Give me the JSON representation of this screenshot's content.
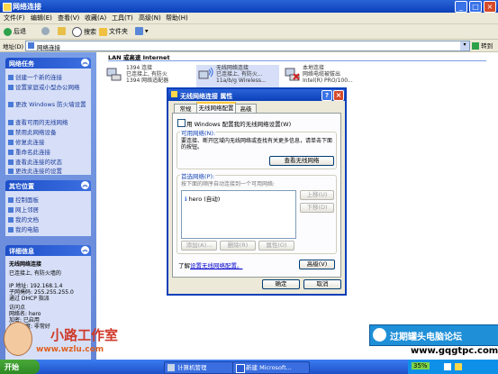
{
  "window": {
    "title": "网络连接"
  },
  "menu": [
    "文件(F)",
    "编辑(E)",
    "查看(V)",
    "收藏(A)",
    "工具(T)",
    "高级(N)",
    "帮助(H)"
  ],
  "toolbar": {
    "back": "后退",
    "search": "搜索",
    "folders": "文件夹"
  },
  "address": {
    "label": "地址(D)",
    "value": "网络连接",
    "go": "转到"
  },
  "left": {
    "network_tasks": {
      "title": "网络任务",
      "items": [
        "创建一个新的连接",
        "设置家庭或小型办公网络",
        "更改 Windows 防火墙设置",
        "查看可用的无线网络",
        "禁用此网络设备",
        "修复此连接",
        "重命名此连接",
        "查看此连接的状态",
        "更改此连接的设置"
      ]
    },
    "other_places": {
      "title": "其它位置",
      "items": [
        "控制面板",
        "网上邻居",
        "我的文档",
        "我的电脑"
      ]
    },
    "details": {
      "title": "详细信息",
      "name": "无线网络连接",
      "status": "已连接上, 有防火墙的",
      "ip": "IP 地址: 192.168.1.4",
      "mask": "子网掩码: 255.255.255.0",
      "dhcp": "通过 DHCP 指派",
      "lines": [
        "访问点",
        "网络名: hero",
        "加密: 已启用",
        "信号强度: 非常好"
      ]
    }
  },
  "main": {
    "group_header": "LAN 或高速 Internet",
    "connections": [
      {
        "name": "1394 连接",
        "status": "已连接上, 有防火",
        "device": "1394 网络适配器"
      },
      {
        "name": "无线网络连接",
        "status": "已连接上, 有防火...",
        "device": "11a/b/g Wireless..."
      },
      {
        "name": "本地连接",
        "status": "网络电缆被拔出",
        "device": "Intel(R) PRO/100..."
      }
    ]
  },
  "dialog": {
    "title": "无线网络连接 属性",
    "tabs": [
      "常规",
      "无线网络配置",
      "高级"
    ],
    "checkbox_label": "用 Windows 配置我的无线网络设置(W)",
    "available": {
      "title": "可用网络(N):",
      "desc": "要连接、断开区域内无线网络或查找有关更多信息，请单击下面的按钮。",
      "button": "查看无线网络"
    },
    "preferred": {
      "title": "首选网络(P):",
      "desc": "按下面的顺序自动连接到一个可用网络:",
      "list": [
        "hero (自动)"
      ],
      "up": "上移(U)",
      "down": "下移(D)",
      "add": "添加(A)...",
      "remove": "删除(R)",
      "props": "属性(O)"
    },
    "learn_prefix": "了解",
    "learn_link": "设置无线网络配置。",
    "advanced": "高级(V)",
    "ok": "确定",
    "cancel": "取消"
  },
  "taskbar": {
    "start": "开始",
    "tasks": [
      "计算机管理",
      "新建 Microsoft..."
    ],
    "tray_text": "35%"
  },
  "watermark": {
    "left_title": "小路工作室",
    "left_url": "www.wzlu.com",
    "right_title": "过期罐头电脑论坛",
    "right_url": "www.gqgtpc.com"
  }
}
